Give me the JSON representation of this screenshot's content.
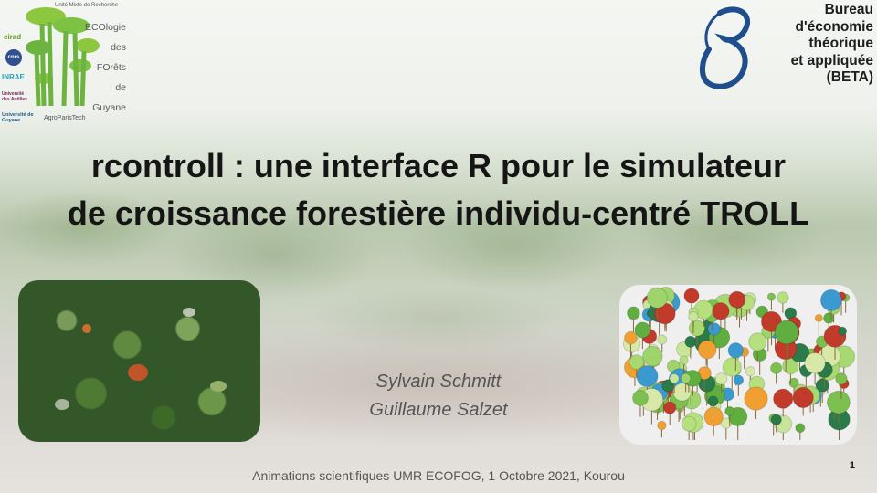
{
  "logos": {
    "ecofog": {
      "umr_caption": "Unité Mixte de Recherche",
      "words": [
        "ECOlogie",
        "des",
        "FOrêts",
        "de",
        "Guyane"
      ],
      "partners": [
        "cirad",
        "cnrs",
        "INRAE",
        "Université des Antilles",
        "Université de Guyane",
        "AgroParisTech"
      ]
    },
    "beta": {
      "lines": [
        "Bureau",
        "d'économie",
        "théorique",
        "et appliquée",
        "(BETA)"
      ]
    }
  },
  "title": {
    "line1": "rcontroll : une interface R pour le simulateur",
    "line2": "de croissance forestière individu-centré TROLL"
  },
  "authors": [
    "Sylvain Schmitt",
    "Guillaume Salzet"
  ],
  "footer": "Animations scientifiques UMR ECOFOG, 1 Octobre 2021, Kourou",
  "page_number": "1",
  "colors": {
    "title": "#151515",
    "author": "#555555",
    "beta_blue": "#1f4e8c",
    "ecofog_green": "#7dc242"
  }
}
